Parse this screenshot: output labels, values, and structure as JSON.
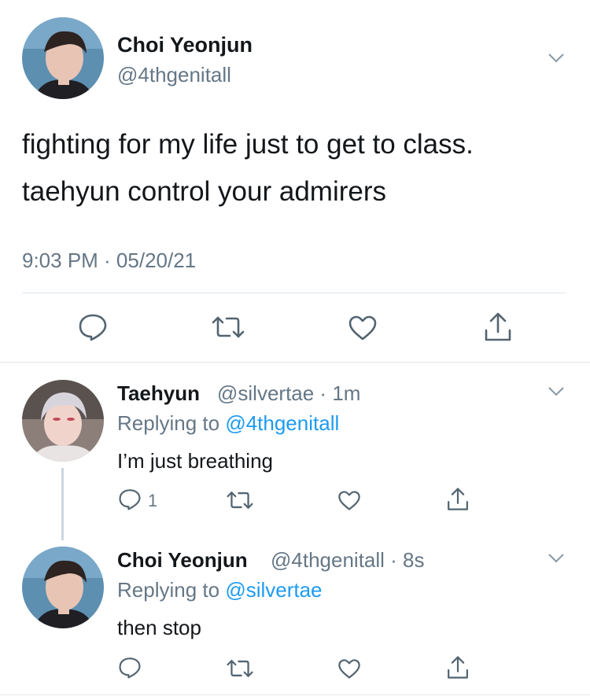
{
  "main_tweet": {
    "display_name": "Choi Yeonjun",
    "handle": "@4thgenitall",
    "text_line1": "fighting for my life just to get to class.",
    "text_line2": "taehyun control your admirers",
    "timestamp": "9:03 PM · 05/20/21"
  },
  "replies": [
    {
      "display_name": "Taehyun",
      "handle_time": "@silvertae · 1m",
      "replying_prefix": "Replying to",
      "replying_handle": "@4thgenitall",
      "text": "I’m just breathing",
      "reply_count": "1"
    },
    {
      "display_name": "Choi Yeonjun",
      "handle_time": "@4thgenitall · 8s",
      "replying_prefix": "Replying to",
      "replying_handle": "@silvertae",
      "text": "then stop",
      "reply_count": ""
    }
  ],
  "colors": {
    "accent": "#1d9bf0",
    "muted": "#657786",
    "icon": "#536471",
    "divider": "#e1e8ed"
  },
  "icons": [
    "chevron-down-icon",
    "reply-icon",
    "retweet-icon",
    "like-icon",
    "share-icon"
  ]
}
